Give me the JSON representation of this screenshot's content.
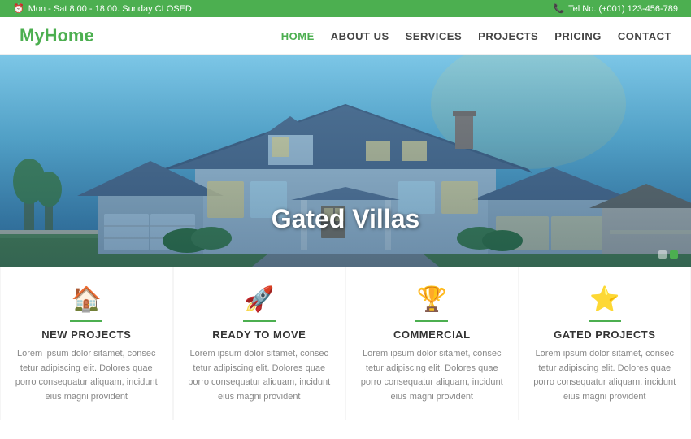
{
  "topbar": {
    "hours": "Mon - Sat 8.00 - 18.00. Sunday CLOSED",
    "phone": "Tel No. (+001) 123-456-789",
    "clock_icon": "⏰",
    "phone_icon": "📞"
  },
  "header": {
    "logo_text_1": "My",
    "logo_text_2": "Home",
    "nav": [
      {
        "label": "HOME",
        "active": true
      },
      {
        "label": "ABOUT US",
        "active": false
      },
      {
        "label": "SERVICES",
        "active": false
      },
      {
        "label": "PROJECTS",
        "active": false
      },
      {
        "label": "PRICING",
        "active": false
      },
      {
        "label": "CONTACT",
        "active": false
      }
    ]
  },
  "hero": {
    "title": "Gated Villas",
    "dots": [
      false,
      true
    ]
  },
  "cards": [
    {
      "icon": "🏠",
      "title": "NEW PROJECTS",
      "text": "Lorem ipsum dolor sitamet, consec tetur adipiscing elit. Dolores quae porro consequatur aliquam, incidunt eius magni provident"
    },
    {
      "icon": "🚀",
      "title": "READY TO MOVE",
      "text": "Lorem ipsum dolor sitamet, consec tetur adipiscing elit. Dolores quae porro consequatur aliquam, incidunt eius magni provident"
    },
    {
      "icon": "🏆",
      "title": "COMMERCIAL",
      "text": "Lorem ipsum dolor sitamet, consec tetur adipiscing elit. Dolores quae porro consequatur aliquam, incidunt eius magni provident"
    },
    {
      "icon": "⭐",
      "title": "GATED PROJECTS",
      "text": "Lorem ipsum dolor sitamet, consec tetur adipiscing elit. Dolores quae porro consequatur aliquam, incidunt eius magni provident"
    }
  ],
  "colors": {
    "green": "#4caf50",
    "dark": "#333333",
    "light_gray": "#f5f5f5"
  }
}
